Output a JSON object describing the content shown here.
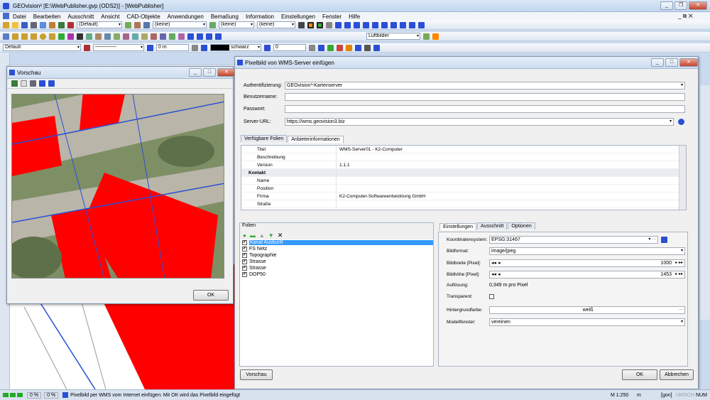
{
  "app": {
    "title": "GEOvision³  [E:\\WebPublisher.gvp (ODS2)] - [WebPublisher]",
    "menu": [
      "Datei",
      "Bearbeiten",
      "Ausschnitt",
      "Ansicht",
      "CAD-Objekte",
      "Anwendungen",
      "Bemaßung",
      "Information",
      "Einstellungen",
      "Fenster",
      "Hilfe"
    ]
  },
  "toolbars": {
    "default_combo": "(Default)",
    "keine_1": "(keine)",
    "keine_2": "(keine)",
    "keine_3": "(keine)",
    "luftbilder": "Luftbilder",
    "style_combo": "Default",
    "size_value": "0 m",
    "color_combo": "schwarz",
    "number_value": "0"
  },
  "preview": {
    "title": "Vorschau",
    "ok": "OK"
  },
  "dialog": {
    "title": "Pixelbild von WMS-Server einfügen",
    "auth_label": "Authentifizierung:",
    "auth_value": "GEOvision³-Kartenserver",
    "user_label": "Benutzername:",
    "user_value": "",
    "pass_label": "Passwort:",
    "pass_value": "",
    "url_label": "Server-URL:",
    "url_value": "https://wms.geovision3.biz",
    "tabs": [
      "Verfügbare Folien",
      "Anbieterinformationen"
    ],
    "props": [
      {
        "k": "Titel",
        "v": "WMS-Server01 - K2-Computer",
        "cat": false
      },
      {
        "k": "Beschreibung",
        "v": "",
        "cat": false
      },
      {
        "k": "Version",
        "v": "1.1.1",
        "cat": false
      },
      {
        "k": "Kontakt",
        "v": "",
        "cat": true
      },
      {
        "k": "Name",
        "v": "",
        "cat": false
      },
      {
        "k": "Position",
        "v": "",
        "cat": false
      },
      {
        "k": "Firma",
        "v": "K2-Computer-Softwareentwicklung GmbH",
        "cat": false
      },
      {
        "k": "Straße",
        "v": "",
        "cat": false
      }
    ],
    "folien_title": "Folien",
    "layers": [
      {
        "name": "Kanal Auskunft",
        "selected": true
      },
      {
        "name": "FS Netz",
        "selected": false
      },
      {
        "name": "Topographie",
        "selected": false
      },
      {
        "name": "Strasse",
        "selected": false
      },
      {
        "name": "Strasse",
        "selected": false
      },
      {
        "name": "DOP50",
        "selected": false
      }
    ],
    "settings_tabs": [
      "Einstellungen",
      "Ausschnitt",
      "Optionen"
    ],
    "settings": {
      "crs_label": "Koordinatensystem:",
      "crs_value": "EPSG:31467",
      "format_label": "Bildformat:",
      "format_value": "image/jpeg",
      "width_label": "Bildbreite [Pixel]:",
      "width_value": "1000",
      "height_label": "Bildhöhe [Pixel]:",
      "height_value": "1453",
      "res_label": "Auflösung:",
      "res_value": "0,349 m pro Pixel",
      "transparent_label": "Transparent:",
      "bg_label": "Hintergrundfarbe:",
      "bg_value": "weiß",
      "model_label": "Modellfenster:",
      "model_value": "vereinen"
    },
    "preview_button": "Vorschau",
    "ok_button": "OK",
    "cancel_button": "Abbrechen"
  },
  "status": {
    "pct1": "0 %",
    "pct2": "0 %",
    "message": "Pixelbild per WMS vom Internet einfügen: Mit OK wird das Pixelbild eingefügt",
    "scale": "M 1:250",
    "unit": "m",
    "gon": "[gon]",
    "umsch": "UMSCH",
    "num": "NUM"
  },
  "colors": {
    "map_red": "#ff0000",
    "accent_blue": "#2a4fd6",
    "selection": "#3399ff"
  }
}
